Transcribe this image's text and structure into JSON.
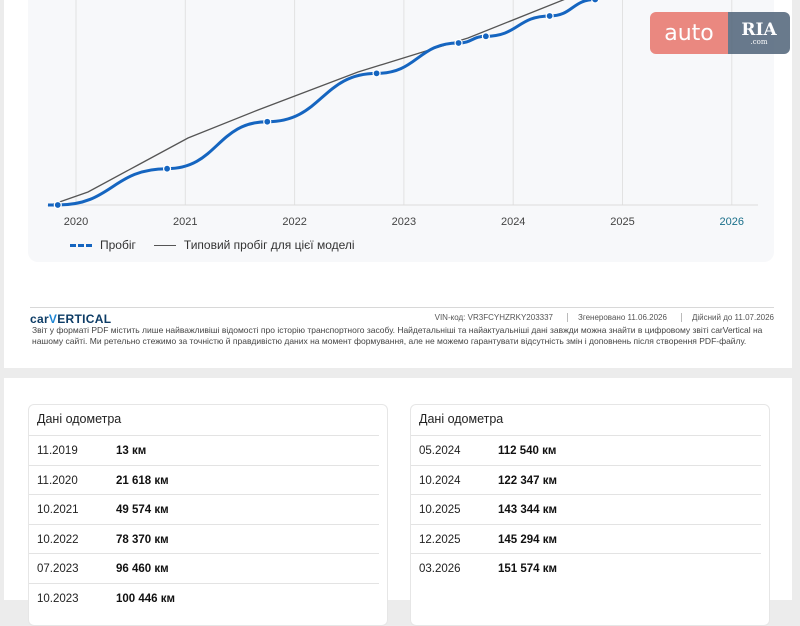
{
  "chart_data": {
    "type": "line",
    "x_ticks": [
      "2020",
      "2021",
      "2022",
      "2023",
      "2024",
      "2025",
      "2026"
    ],
    "highlight_tick": "2026",
    "series": [
      {
        "name": "Пробіг",
        "style": "dashed-with-markers",
        "color": "#1565c0",
        "points": [
          {
            "x": "11.2019",
            "y": 13
          },
          {
            "x": "11.2020",
            "y": 21618
          },
          {
            "x": "10.2021",
            "y": 49574
          },
          {
            "x": "10.2022",
            "y": 78370
          },
          {
            "x": "07.2023",
            "y": 96460
          },
          {
            "x": "10.2023",
            "y": 100446
          },
          {
            "x": "05.2024",
            "y": 112540
          },
          {
            "x": "10.2024",
            "y": 122347
          }
        ]
      },
      {
        "name": "Типовий пробіг для цієї моделі",
        "style": "solid",
        "color": "#555555"
      }
    ]
  },
  "footer": {
    "logo_part1": "car",
    "logo_part2": "V",
    "logo_part3": "ERTICAL",
    "vin_label": "VIN-код:",
    "vin": "VR3FCYHZRKY203337",
    "generated_label": "Згенеровано",
    "generated": "11.06.2026",
    "valid_label": "Дійсний до",
    "valid": "11.07.2026",
    "disclaimer": "Звіт у форматі PDF містить лише найважливіші відомості про історію транспортного засобу. Найдетальніші та найактуальніші дані завжди можна знайти в цифровому звіті carVertical на нашому сайті. Ми ретельно стежимо за точністю й правдивістю даних на момент формування, але не можемо гарантувати відсутність змін і доповнень після створення PDF-файлу."
  },
  "watermark": {
    "auto": "auto",
    "ria": "RIA",
    "ria_sub": ".com"
  },
  "odometer_left": {
    "title": "Дані одометра",
    "rows": [
      {
        "date": "11.2019",
        "value": "13 км"
      },
      {
        "date": "11.2020",
        "value": "21 618 км"
      },
      {
        "date": "10.2021",
        "value": "49 574 км"
      },
      {
        "date": "10.2022",
        "value": "78 370 км"
      },
      {
        "date": "07.2023",
        "value": "96 460 км"
      },
      {
        "date": "10.2023",
        "value": "100 446 км"
      }
    ]
  },
  "odometer_right": {
    "title": "Дані одометра",
    "rows": [
      {
        "date": "05.2024",
        "value": "112 540 км"
      },
      {
        "date": "10.2024",
        "value": "122 347 км"
      },
      {
        "date": "10.2025",
        "value": "143 344 км"
      },
      {
        "date": "12.2025",
        "value": "145 294 км"
      },
      {
        "date": "03.2026",
        "value": "151 574 км"
      }
    ]
  },
  "colors": {
    "accent": "#1565c0",
    "typical": "#555555",
    "highlight_year": "#1a6f8a"
  }
}
